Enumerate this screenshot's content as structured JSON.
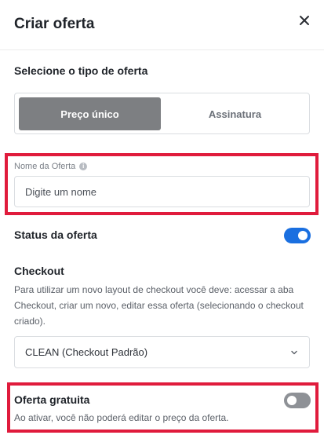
{
  "header": {
    "title": "Criar oferta",
    "close_icon": "close-icon"
  },
  "offer_type": {
    "label": "Selecione o tipo de oferta",
    "options": [
      {
        "label": "Preço único",
        "selected": true
      },
      {
        "label": "Assinatura",
        "selected": false
      }
    ]
  },
  "offer_name": {
    "label": "Nome da Oferta",
    "info_icon": "info-icon",
    "placeholder": "Digite um nome",
    "value": ""
  },
  "status": {
    "label": "Status da oferta",
    "enabled": true
  },
  "checkout": {
    "title": "Checkout",
    "description": "Para utilizar um novo layout de checkout você deve: acessar a aba Checkout, criar um novo, editar essa oferta (selecionando o checkout criado).",
    "selected": "CLEAN (Checkout Padrão)",
    "chevron_icon": "chevron-down-icon"
  },
  "free_offer": {
    "title": "Oferta gratuita",
    "description": "Ao ativar, você não poderá editar o preço da oferta.",
    "enabled": false
  },
  "colors": {
    "highlight": "#e01b3c",
    "toggle_on": "#1a6fe0",
    "toggle_off": "#8e9196",
    "segment_active": "#7d7f82"
  }
}
